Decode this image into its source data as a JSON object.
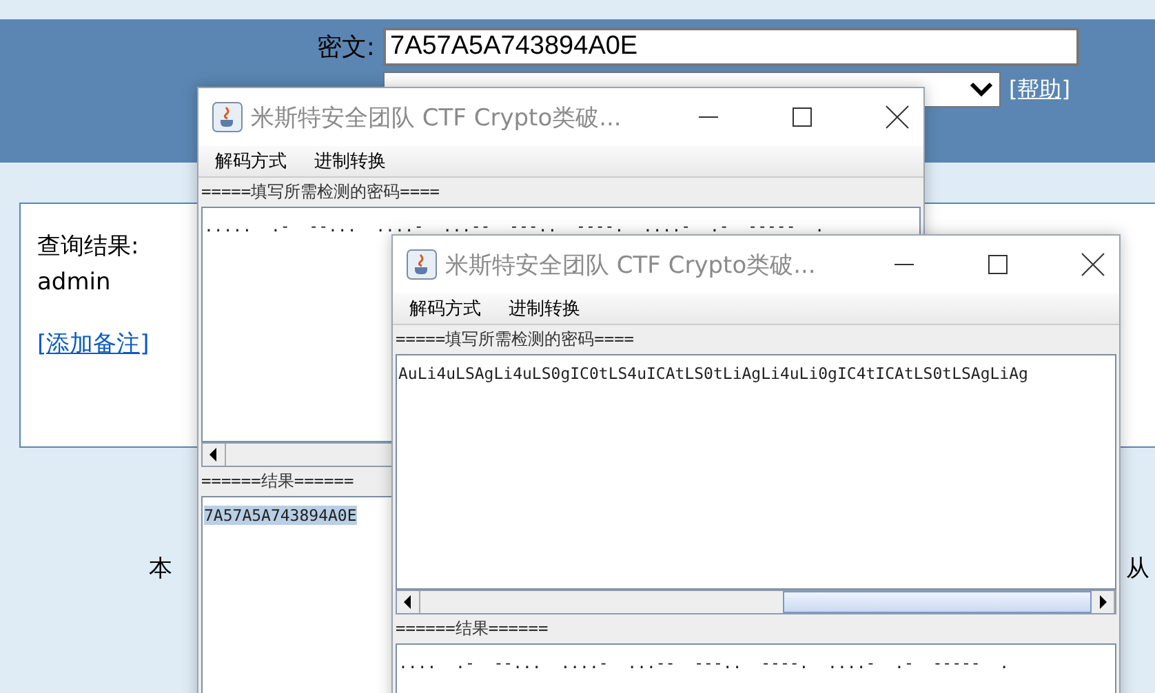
{
  "page": {
    "cipher_label": "密文:",
    "cipher_value": "7A57A5A743894A0E",
    "help_link": "[帮助]",
    "result_title": "查询结果:",
    "result_value": "admin",
    "add_note_link": "[添加备注]",
    "footer_left": "本",
    "footer_right": "从"
  },
  "windows": [
    {
      "title": "米斯特安全团队 CTF Crypto类破...",
      "menus": [
        "解码方式",
        "进制转换"
      ],
      "input_label": "=====填写所需检测的密码====",
      "input_text": ".....  .-  --...  ....-  ...--  ---..  ----.  ....-  .-  -----  .",
      "result_label": "======结果======",
      "result_text": "7A57A5A743894A0E",
      "result_highlighted": true
    },
    {
      "title": "米斯特安全团队 CTF Crypto类破...",
      "menus": [
        "解码方式",
        "进制转换"
      ],
      "input_label": "=====填写所需检测的密码====",
      "input_text": "AuLi4uLSAgLi4uLS0gIC0tLS4uICAtLS0tLiAgLi4uLi0gIC4tICAtLS0tLSAgLiAg",
      "result_label": "======结果======",
      "result_text": "....  .-  --...  ....-  ...--  ---..  ----.  ....-  .-  -----  .",
      "result_highlighted": false
    }
  ]
}
